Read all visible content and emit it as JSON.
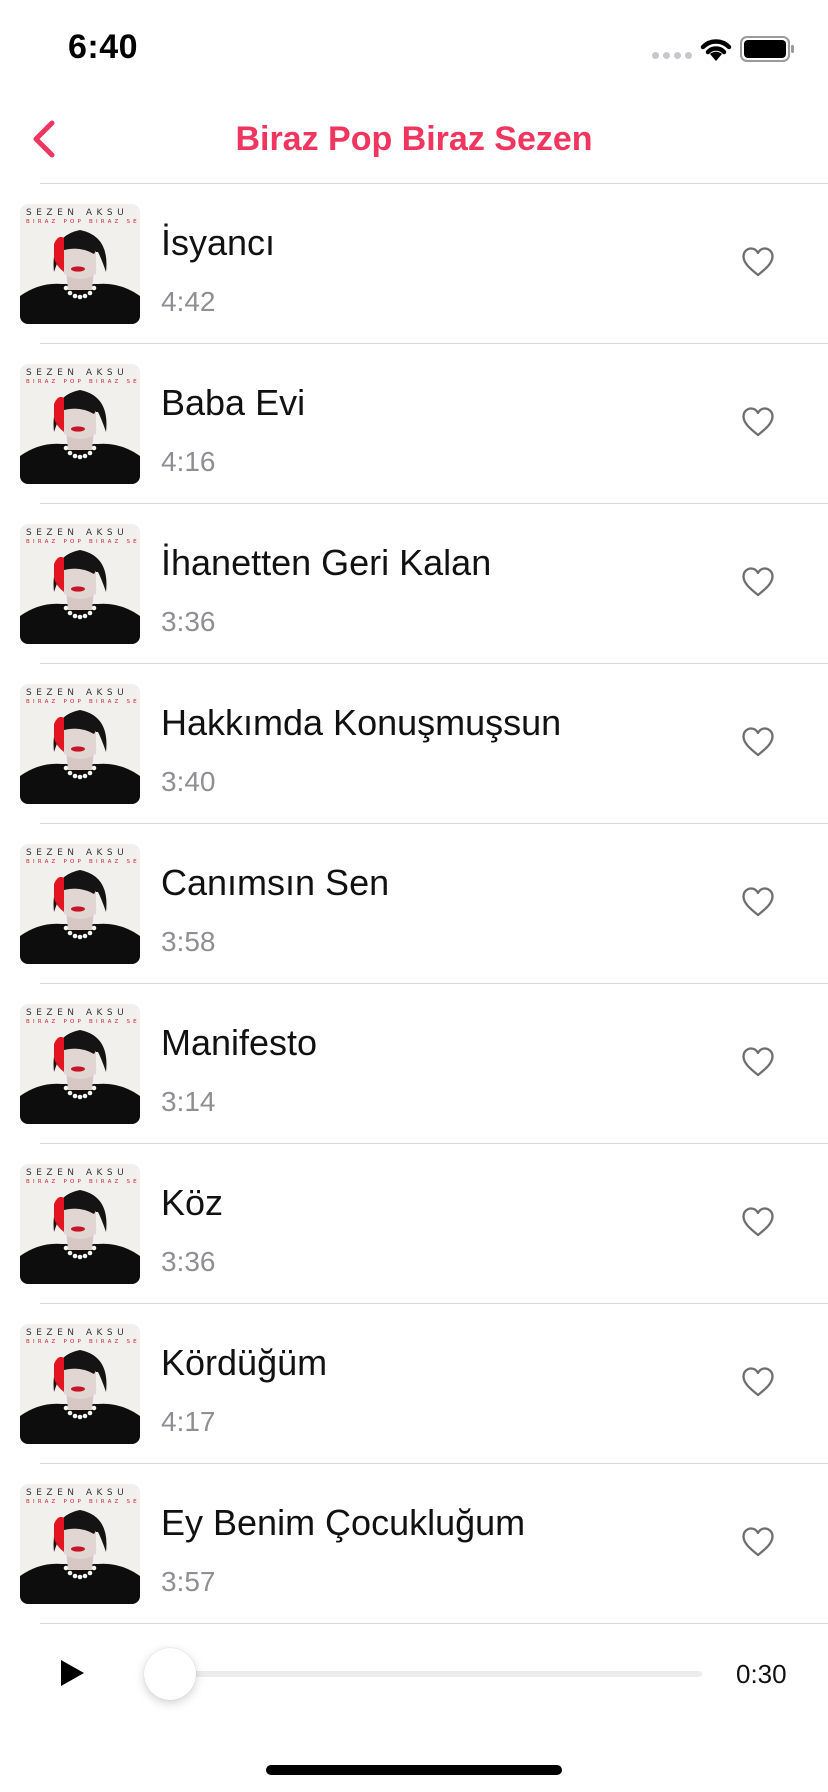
{
  "status_bar": {
    "time": "6:40"
  },
  "nav": {
    "title": "Biraz Pop Biraz Sezen",
    "back_icon": "chevron-left-icon"
  },
  "colors": {
    "accent": "#f0355f",
    "secondary_text": "#8e8e93",
    "divider": "#d9d9dc"
  },
  "album_cover": {
    "artist_text": "SEZEN AKSU",
    "album_text": "BIRAZ POP BIRAZ SEZEN"
  },
  "tracks": [
    {
      "title": "İsyancı",
      "duration": "4:42",
      "liked": false
    },
    {
      "title": "Baba Evi",
      "duration": "4:16",
      "liked": false
    },
    {
      "title": "İhanetten Geri Kalan",
      "duration": "3:36",
      "liked": false
    },
    {
      "title": "Hakkımda Konuşmuşsun",
      "duration": "3:40",
      "liked": false
    },
    {
      "title": "Canımsın Sen",
      "duration": "3:58",
      "liked": false
    },
    {
      "title": "Manifesto",
      "duration": "3:14",
      "liked": false
    },
    {
      "title": "Köz",
      "duration": "3:36",
      "liked": false
    },
    {
      "title": "Kördüğüm",
      "duration": "4:17",
      "liked": false
    },
    {
      "title": "Ey Benim Çocukluğum",
      "duration": "3:57",
      "liked": false
    }
  ],
  "player": {
    "play_icon": "play-icon",
    "progress": 0.0,
    "time_remaining": "0:30"
  }
}
